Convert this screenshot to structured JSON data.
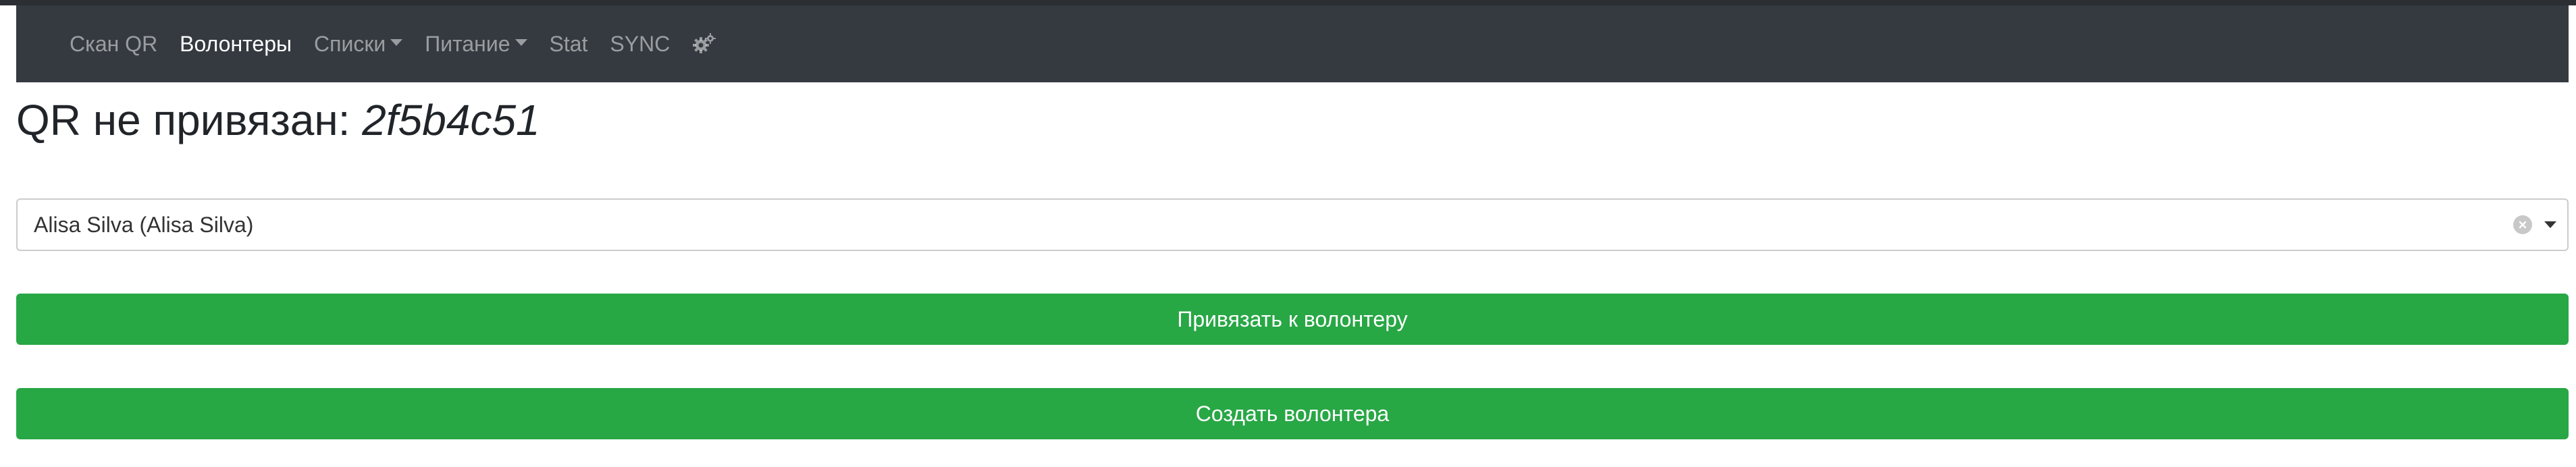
{
  "nav": {
    "items": [
      {
        "label": "Скан QR",
        "active": false,
        "dropdown": false
      },
      {
        "label": "Волонтеры",
        "active": true,
        "dropdown": false
      },
      {
        "label": "Списки",
        "active": false,
        "dropdown": true
      },
      {
        "label": "Питание",
        "active": false,
        "dropdown": true
      },
      {
        "label": "Stat",
        "active": false,
        "dropdown": false
      },
      {
        "label": "SYNC",
        "active": false,
        "dropdown": false
      }
    ],
    "settings_icon": "gears-icon"
  },
  "page": {
    "title_prefix": "QR не привязан: ",
    "qr_code": "2f5b4c51"
  },
  "select": {
    "value": "Alisa Silva (Alisa Silva)",
    "clear_icon": "clear-icon",
    "arrow_icon": "chevron-down-icon"
  },
  "buttons": {
    "bind_label": "Привязать к волонтеру",
    "create_label": "Создать волонтера",
    "color": "#28a745"
  },
  "colors": {
    "navbar": "#343a40",
    "button": "#28a745"
  }
}
